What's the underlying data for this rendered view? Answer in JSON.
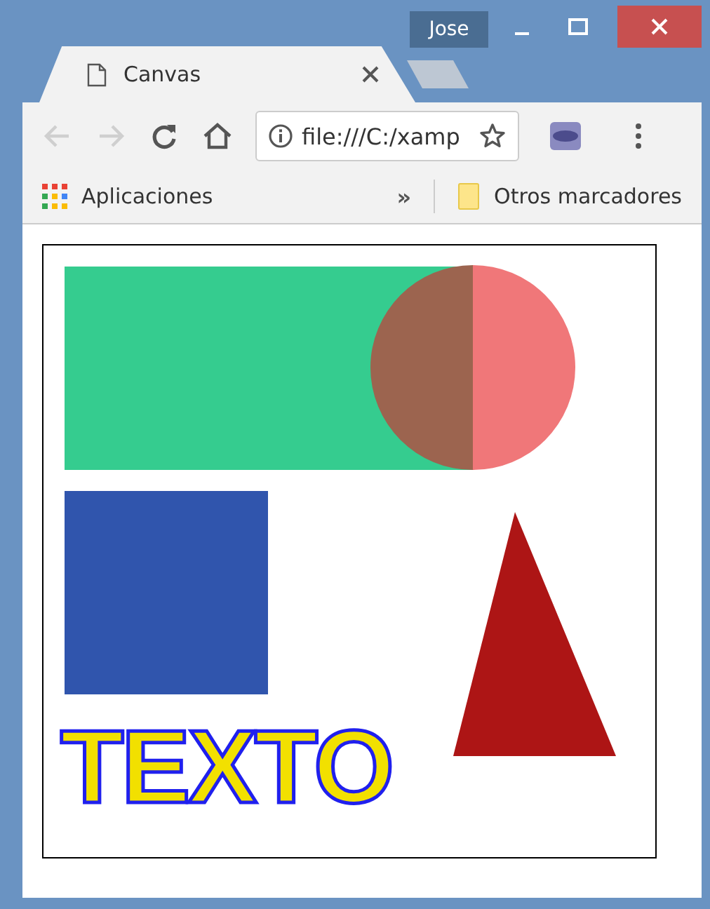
{
  "window": {
    "user": "Jose"
  },
  "tabs": [
    {
      "title": "Canvas",
      "selected": true
    }
  ],
  "navigation": [
    {
      "kind": "back",
      "disabled": true
    },
    {
      "kind": "forward",
      "disabled": true
    },
    {
      "kind": "reload",
      "disabled": false
    },
    {
      "kind": "home",
      "disabled": false
    }
  ],
  "address_bar": {
    "value": "file:///C:/xamp"
  },
  "bookmarks_bar": {
    "items": [
      "Aplicaciones"
    ],
    "overflow": "»",
    "other": "Otros marcadores"
  },
  "canvas": {
    "text": "TEXTO"
  }
}
